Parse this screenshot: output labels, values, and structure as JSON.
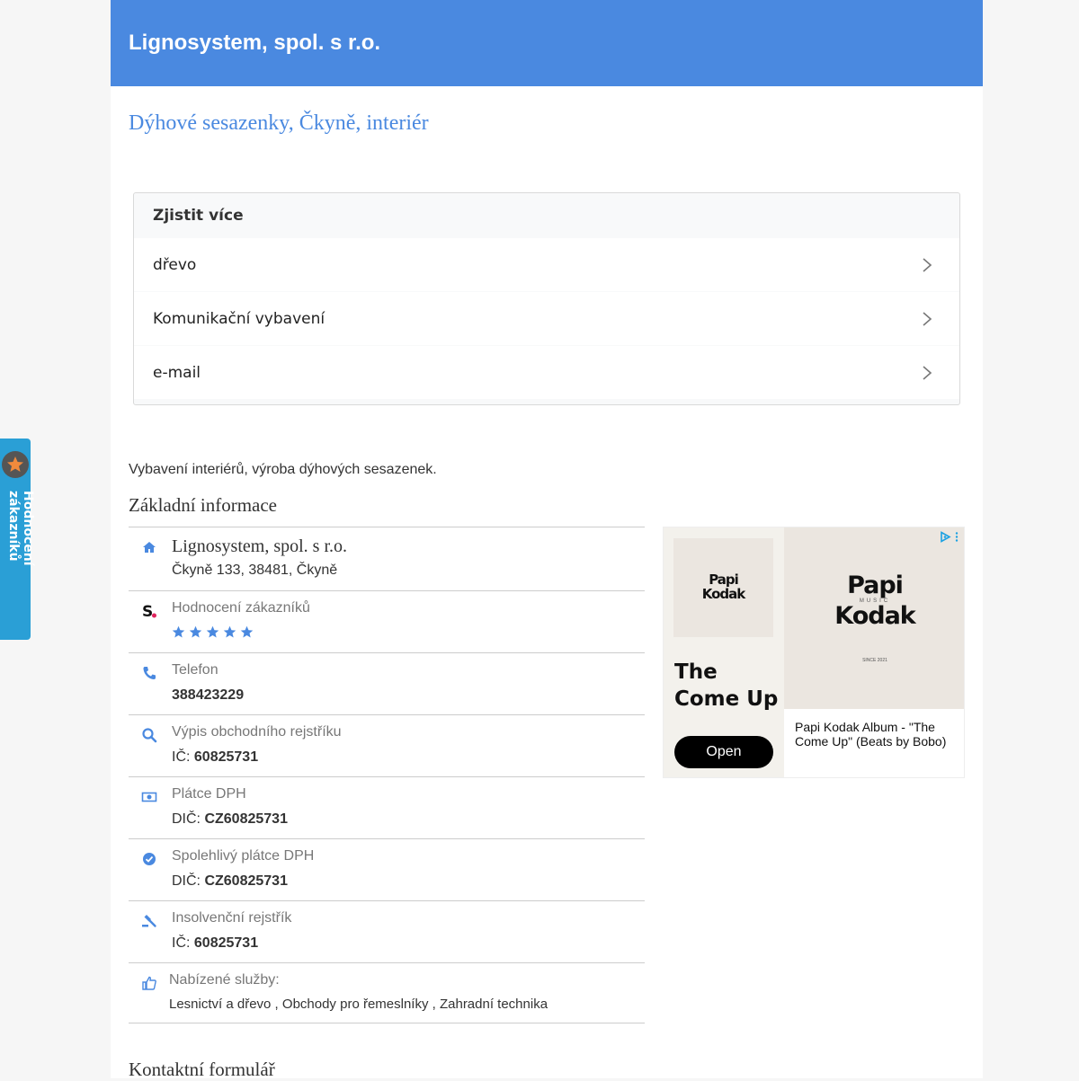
{
  "header": {
    "title": "Lignosystem, spol. s r.o."
  },
  "subtitle": "Dýhové sesazenky, Čkyně, interiér",
  "more": {
    "heading": "Zjistit více",
    "items": [
      "dřevo",
      "Komunikační vybavení",
      "e-mail"
    ]
  },
  "description": "Vybavení interiérů, výroba dýhových sesazenek.",
  "basic_info": {
    "title": "Základní informace",
    "company": {
      "name": "Lignosystem, spol. s r.o.",
      "address": "Čkyně 133, 38481, Čkyně"
    },
    "rating": {
      "label": "Hodnocení zákazníků",
      "stars": 5
    },
    "phone": {
      "label": "Telefon",
      "value": "388423229"
    },
    "registry": {
      "label": "Výpis obchodního rejstříku",
      "prefix": "IČ:",
      "value": "60825731"
    },
    "vat": {
      "label": "Plátce DPH",
      "prefix": "DIČ:",
      "value": "CZ60825731"
    },
    "reliable_vat": {
      "label": "Spolehlivý plátce DPH",
      "prefix": "DIČ:",
      "value": "CZ60825731"
    },
    "insolvency": {
      "label": "Insolvenční rejstřík",
      "prefix": "IČ:",
      "value": "60825731"
    },
    "services": {
      "label": "Nabízené služby:",
      "value": "Lesnictví a dřevo , Obchody pro řemeslníky , Zahradní technika"
    }
  },
  "contact_title": "Kontaktní formulář",
  "ad": {
    "cover_line1": "Papi",
    "cover_line2": "Kodak",
    "cover_tiny": "MUSIC",
    "cover_since": "SINCE 2021",
    "title_line1": "The",
    "title_line2": "Come Up",
    "button": "Open",
    "caption": "Papi Kodak Album - \"The Come Up\" (Beats by Bobo)"
  },
  "side_tab": {
    "label": "Hodnocení zákazníků"
  },
  "colors": {
    "accent": "#4a89e0",
    "side_tab": "#2a9fd6"
  }
}
